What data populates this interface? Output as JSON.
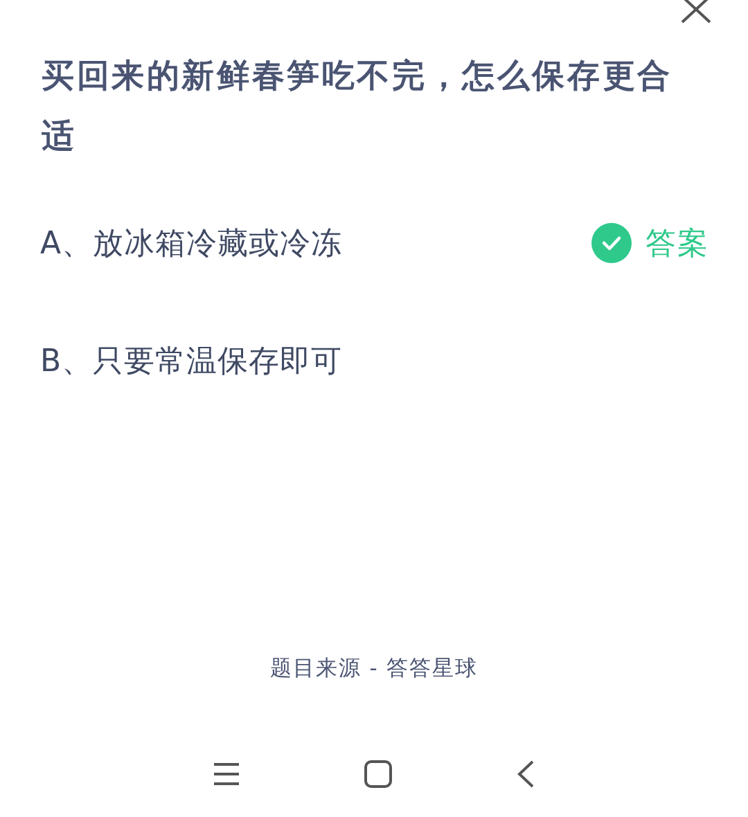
{
  "question": "买回来的新鲜春笋吃不完，怎么保存更合适",
  "answer_label": "答案",
  "options": [
    {
      "label": "A、放冰箱冷藏或冷冻",
      "correct": true
    },
    {
      "label": "B、只要常温保存即可",
      "correct": false
    }
  ],
  "source": "题目来源 - 答答星球"
}
